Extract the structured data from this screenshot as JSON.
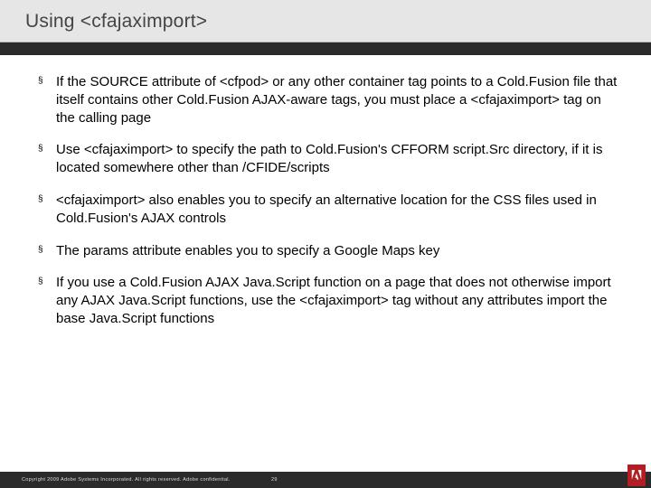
{
  "header": {
    "title": "Using <cfajaximport>"
  },
  "bullets": [
    "If the SOURCE attribute of <cfpod> or any other container tag points to a Cold.Fusion file that itself contains other Cold.Fusion AJAX-aware tags, you must place a <cfajaximport> tag on the calling page",
    "Use <cfajaximport> to specify the path to Cold.Fusion's CFFORM script.Src directory, if it is located somewhere other than /CFIDE/scripts",
    "<cfajaximport> also enables you to specify an alternative location for the CSS files used in Cold.Fusion's AJAX controls",
    "The params attribute enables you to specify a Google Maps key",
    "If you use a Cold.Fusion AJAX Java.Script function on a page that does not otherwise import any AJAX Java.Script functions, use the <cfajaximport> tag without any attributes import the base Java.Script functions"
  ],
  "footer": {
    "copyright": "Copyright 2009 Adobe Systems Incorporated.  All rights reserved.  Adobe confidential.",
    "page": "29"
  }
}
